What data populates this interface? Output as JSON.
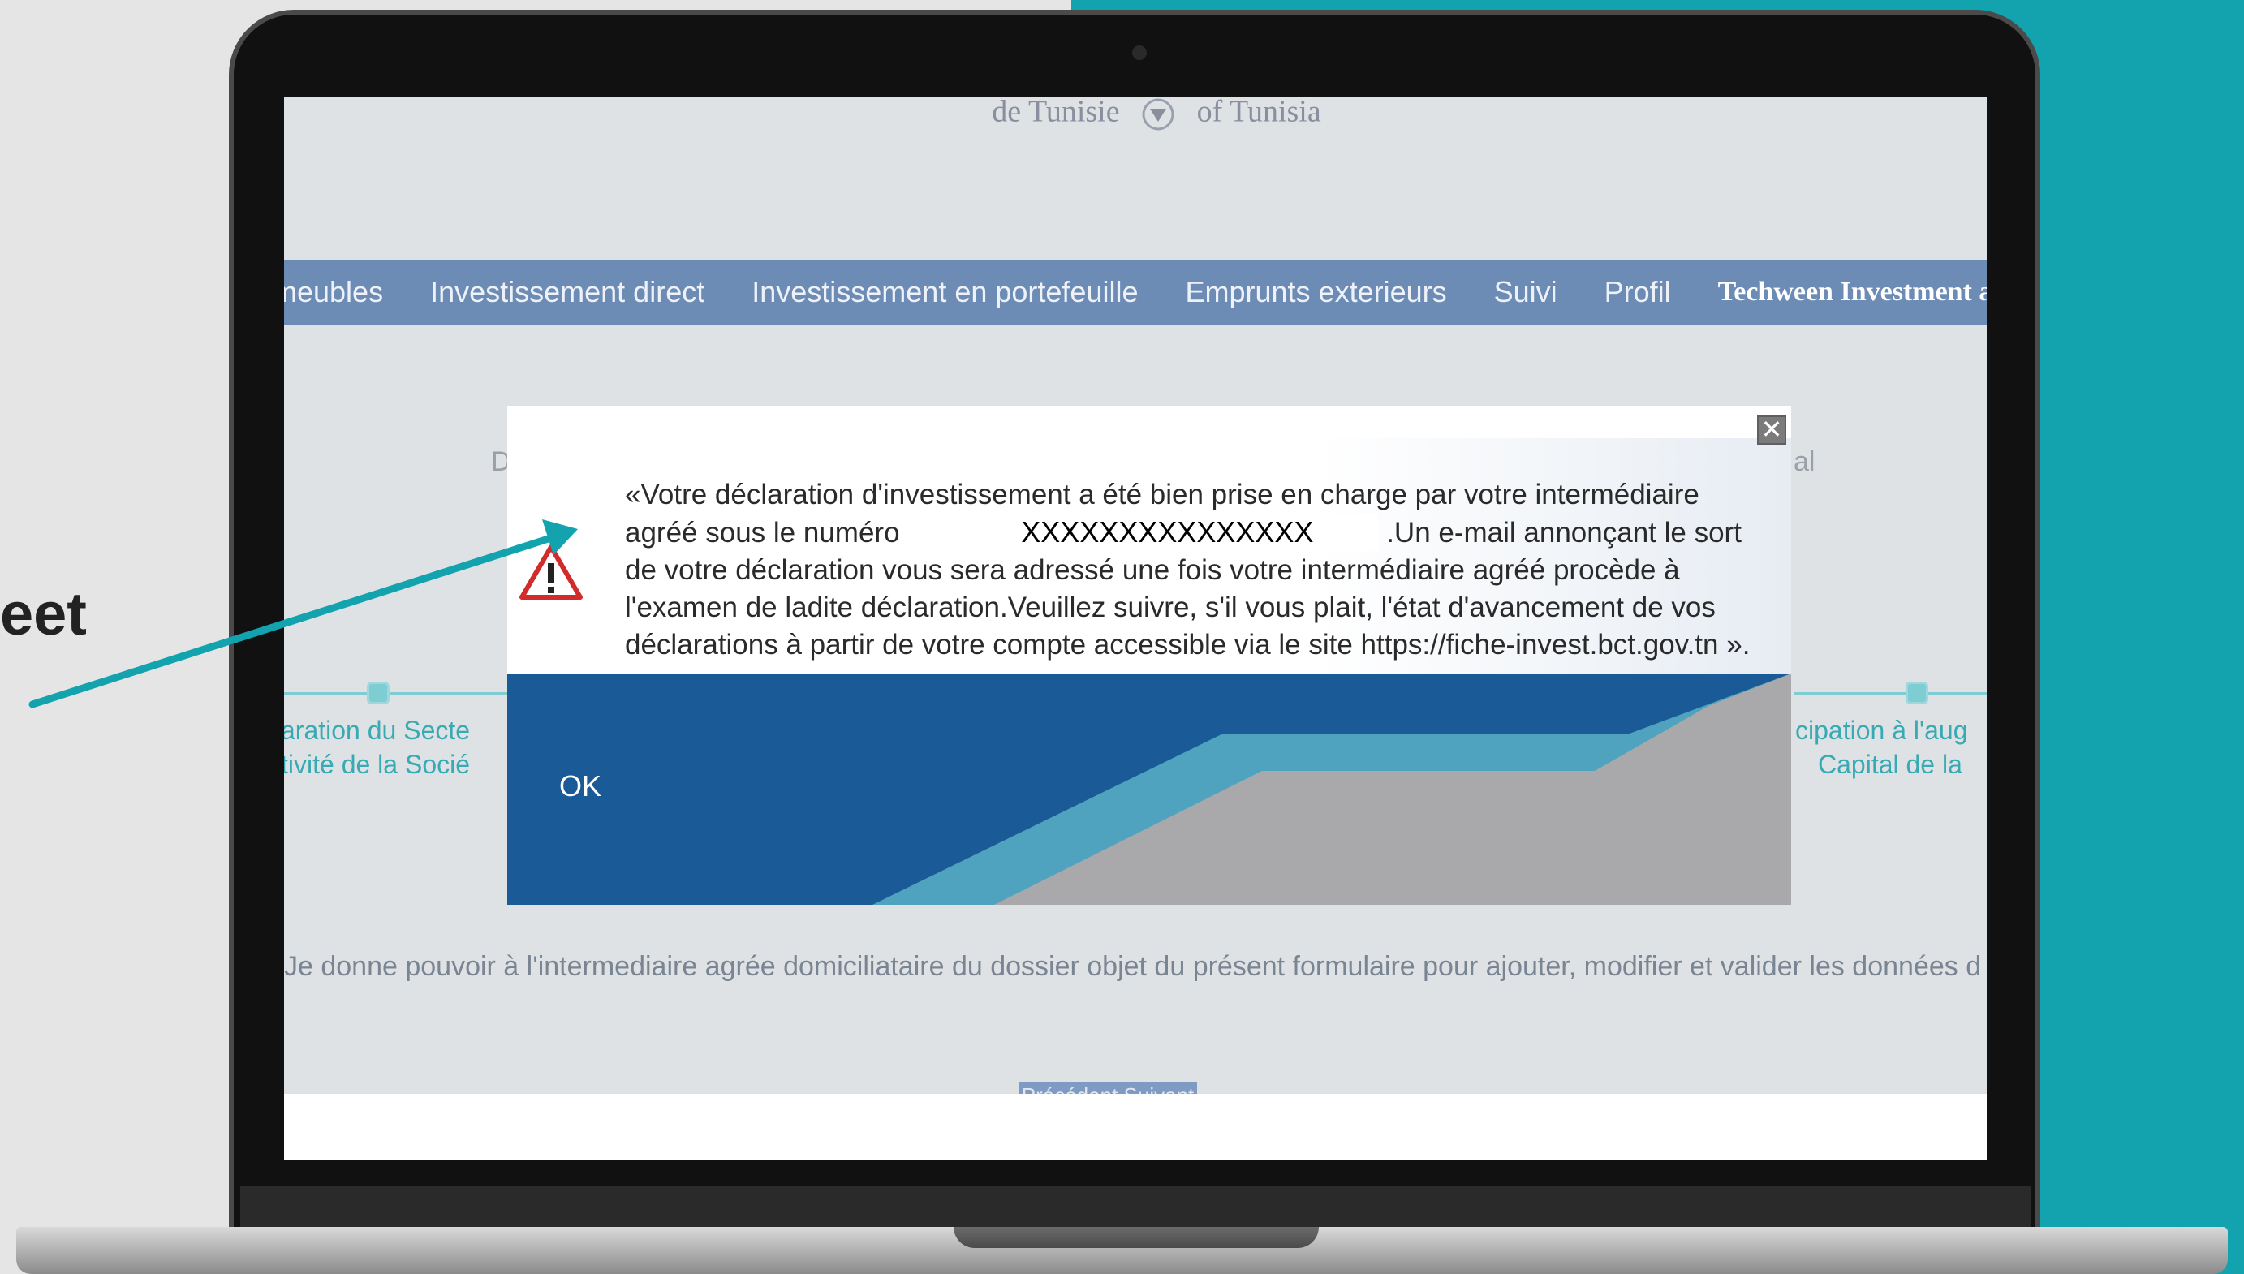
{
  "backdrop": {
    "side_text": "eet",
    "accent_color": "#13a3ae"
  },
  "page": {
    "header_logo": {
      "left_text": "de Tunisie",
      "right_text": "of Tunisia"
    },
    "nav": {
      "items": [
        "meubles",
        "Investissement direct",
        "Investissement en portefeuille",
        "Emprunts exterieurs",
        "Suivi",
        "Profil",
        "Techween Investment and De"
      ]
    },
    "steps": {
      "left_line1": "aration du Secte",
      "left_line2": "tivité de la Socié",
      "right_line1": "cipation à l'aug",
      "right_line2": "Capital de la",
      "faint_left": "D",
      "faint_right": "al"
    },
    "consent_text": "Je donne pouvoir à l'intermediaire agrée domiciliataire du dossier objet du présent formulaire pour ajouter, modifier et valider les données d",
    "nav_buttons_text": "Précédent  Suivant"
  },
  "dialog": {
    "close_symbol": "✕",
    "message_part1": "«Votre déclaration d'investissement a été bien prise en charge par votre intermédiaire agréé sous le numéro",
    "masked_number": "XXXXXXXXXXXXXXX",
    "message_part2": ".Un e-mail annonçant le sort de votre déclaration vous sera adressé une fois votre intermédiaire agréé procède à l'examen de ladite déclaration.Veuillez suivre, s'il vous plait, l'état d'avancement de vos déclarations à partir de votre compte accessible via le site https://fiche-invest.bct.gov.tn ».",
    "ok_label": "OK",
    "colors": {
      "blue": "#1a5a96",
      "teal": "#4fa3bf",
      "grey": "#a9a9ab"
    }
  }
}
